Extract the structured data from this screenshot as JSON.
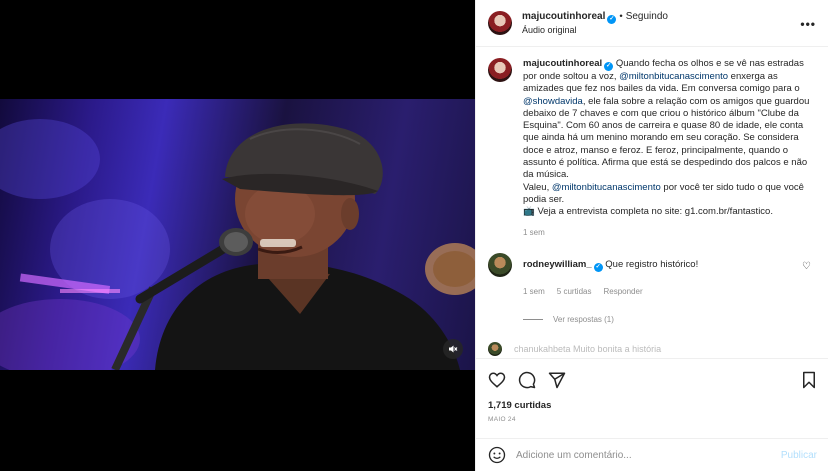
{
  "post": {
    "username": "majucoutinhoreal",
    "follow_status": "Seguindo",
    "dot": "•",
    "audio": "Áudio original",
    "verified_mark": "✓"
  },
  "caption": {
    "username": "majucoutinhoreal",
    "part1": "Quando fecha os olhos e se vê nas estradas por onde soltou a voz, ",
    "mention1": "@miltonbitucanascimento",
    "part2": " enxerga as amizades que fez nos bailes da vida. Em conversa comigo para o ",
    "mention2": "@showdavida",
    "part3": ", ele fala sobre a relação com os amigos que guardou debaixo de 7 chaves e com que criou o histórico álbum \"Clube da Esquina\". Com 60 anos de carreira e quase 80 de idade, ele conta que ainda há um menino morando em seu coração. Se considera doce e atroz, manso e feroz. E feroz, principalmente, quando o assunto é política. Afirma que está se despedindo dos palcos e não da música.",
    "part4": "Valeu, ",
    "mention3": "@miltonbitucanascimento",
    "part5": " por você ter sido tudo o que você podia ser.",
    "part6": "📺 Veja a entrevista completa no site: g1.com.br/fantastico.",
    "time": "1 sem"
  },
  "comments": [
    {
      "username": "rodneywilliam_",
      "text": "Que registro histórico!",
      "time": "1 sem",
      "likes": "5 curtidas",
      "reply": "Responder",
      "view_replies": "Ver respostas (1)"
    }
  ],
  "partial_comment": "chanukahbeta Muito bonita a história",
  "stats": {
    "likes": "1,719 curtidas",
    "date": "MAIO 24"
  },
  "composer": {
    "placeholder": "Adicione um comentário...",
    "publish": "Publicar"
  },
  "icons": {
    "more": "more-options-icon",
    "mute": "muted-speaker-icon",
    "like": "heart-icon",
    "comment": "comment-bubble-icon",
    "share": "paper-plane-icon",
    "save": "bookmark-icon",
    "emoji": "emoji-icon"
  },
  "colors": {
    "link": "#00376b",
    "verified": "#0095f6",
    "publish_disabled": "#b2dffc",
    "muted_text": "#8e8e8e"
  }
}
